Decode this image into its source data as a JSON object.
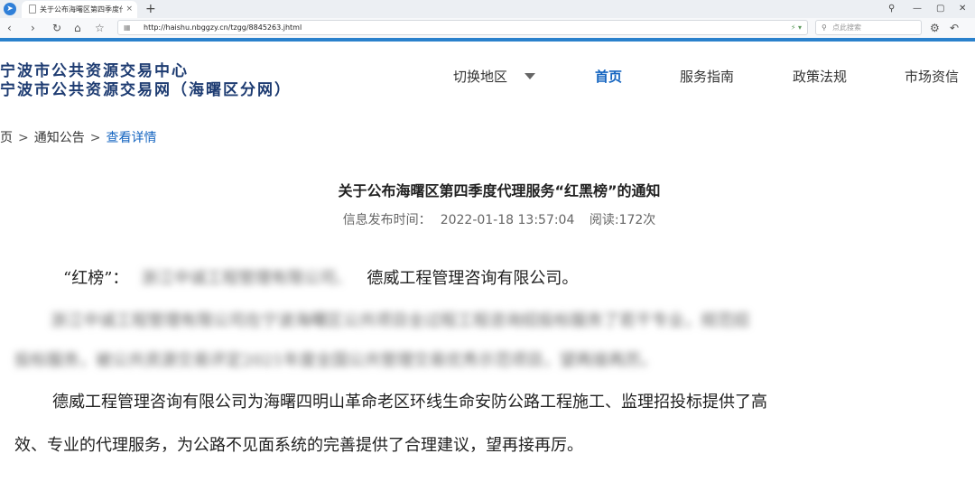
{
  "browser": {
    "tab_title": "关于公布海曙区第四季度代理服务",
    "tab_close": "×",
    "new_tab": "+",
    "url": "http://haishu.nbggzy.cn/tzgg/8845263.jhtml",
    "search_placeholder": "点此搜索",
    "nav_back": "‹",
    "nav_forward": "›",
    "nav_reload": "↻",
    "nav_home": "⌂",
    "nav_star": "☆",
    "win_controls": [
      "⚲",
      "—",
      "▢",
      "✕"
    ]
  },
  "site": {
    "logo_line1": "宁波市公共资源交易中心",
    "logo_line2": "宁波市公共资源交易网（海曙区分网）",
    "menu": {
      "region": "切换地区",
      "home": "首页",
      "guide": "服务指南",
      "policy": "政策法规",
      "market": "市场资信"
    }
  },
  "breadcrumb": {
    "root": "页",
    "notices": "通知公告",
    "current": "查看详情",
    "separator": ">"
  },
  "article": {
    "title": "关于公布海曙区第四季度代理服务“红黑榜”的通知",
    "publish_label": "信息发布时间：",
    "publish_time": "2022-01-18 13:57:04",
    "reads_label": "阅读:172次",
    "red_label": "“红榜”：",
    "red_blurred": "浙江中诚工程管理有限公司、",
    "red_company": "德威工程管理咨询有限公司。",
    "blur_line1": "浙江中诚工程管理有限公司在宁波海曙区公共项目全过程工程咨询招投标服务了若干专业，规范招",
    "blur_line2": "投标服务，被公共资源交易评定2021年度全国公共管理交易优秀示范项目，望再接再厉。",
    "body_line1": "德威工程管理咨询有限公司为海曙四明山革命老区环线生命安防公路工程施工、监理招投标提供了高",
    "body_line2": "效、专业的代理服务，为公路不见面系统的完善提供了合理建议，望再接再厉。"
  },
  "colors": {
    "accent": "#2a81cc",
    "nav_active": "#1565c0",
    "logo": "#1e3c72"
  }
}
